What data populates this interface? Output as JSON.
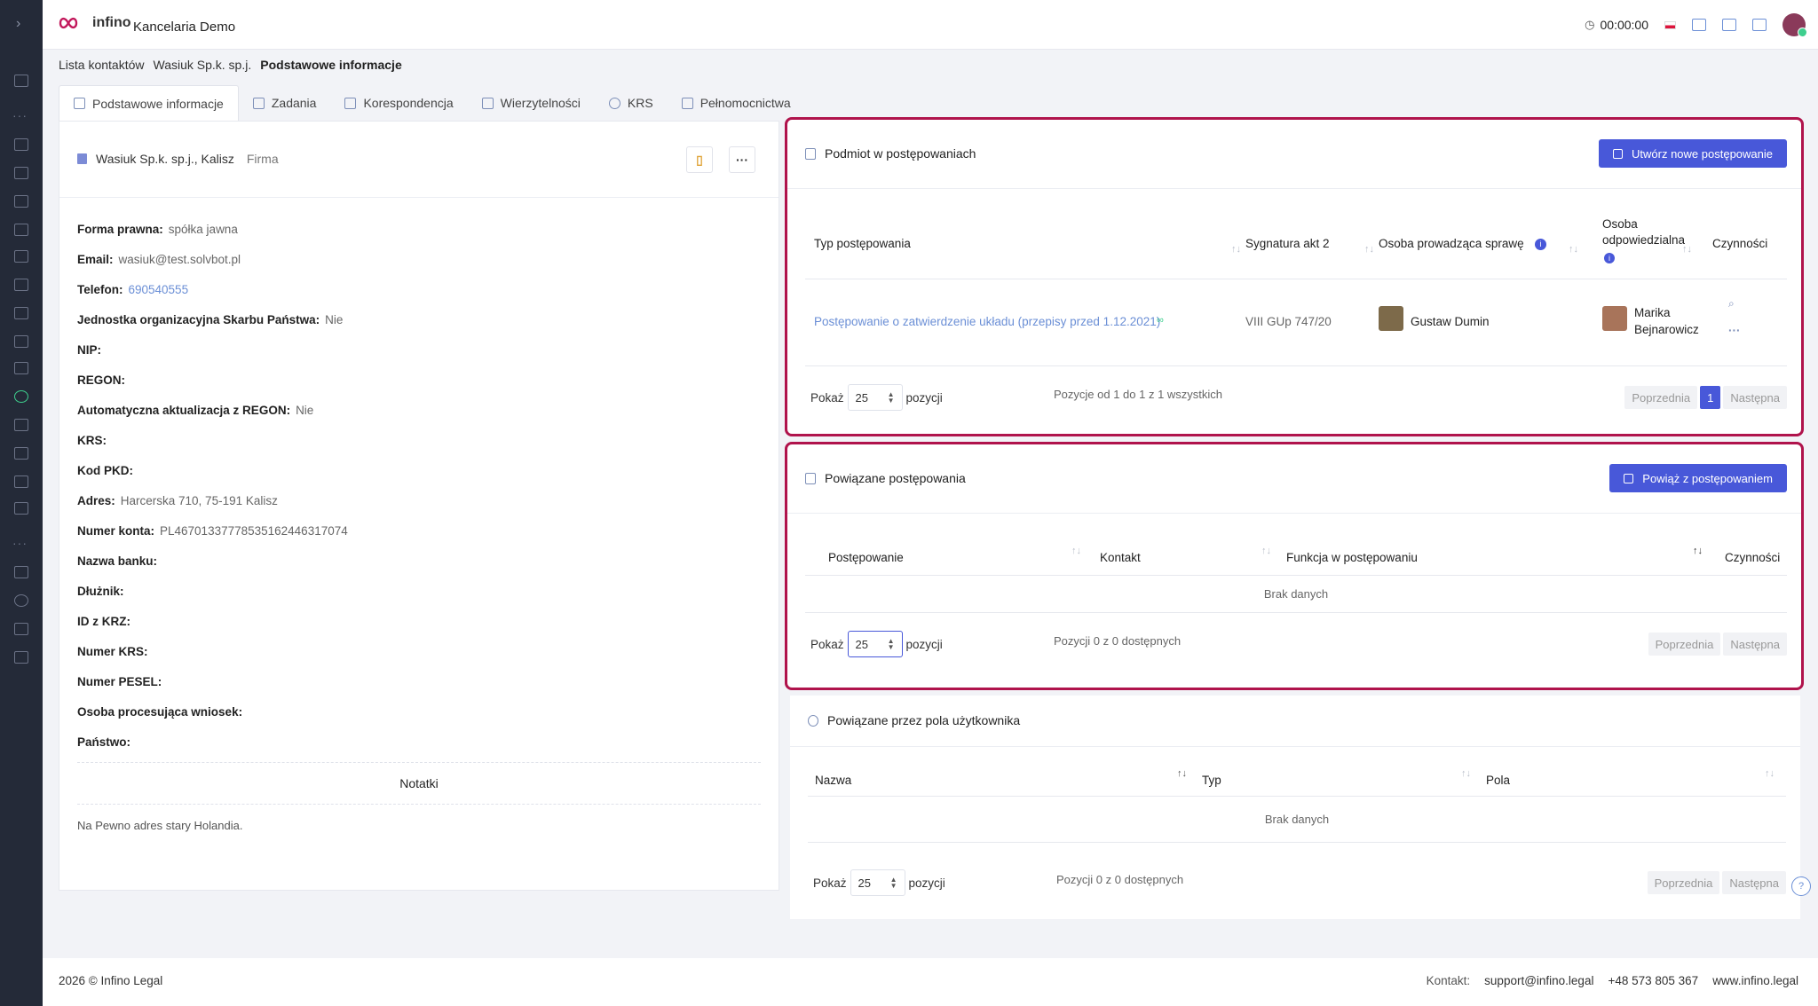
{
  "app": {
    "firm_name": "Kancelaria Demo",
    "logo_text": "infino",
    "timer": "00:00:00"
  },
  "breadcrumb": [
    "Lista kontaktów",
    "Wasiuk Sp.k. sp.j.",
    "Podstawowe informacje"
  ],
  "tabs": [
    "Podstawowe informacje",
    "Zadania",
    "Korespondencja",
    "Wierzytelności",
    "KRS",
    "Pełnomocnictwa"
  ],
  "left": {
    "title": "Wasiuk Sp.k. sp.j., Kalisz",
    "type": "Firma",
    "fields": [
      {
        "label": "Forma prawna:",
        "value": "spółka jawna"
      },
      {
        "label": "Email:",
        "value": "wasiuk@test.solvbot.pl"
      },
      {
        "label": "Telefon:",
        "value": "690540555"
      },
      {
        "label": "Jednostka organizacyjna Skarbu Państwa:",
        "value": "Nie"
      },
      {
        "label": "NIP:",
        "value": ""
      },
      {
        "label": "REGON:",
        "value": ""
      },
      {
        "label": "Automatyczna aktualizacja z REGON:",
        "value": "Nie"
      },
      {
        "label": "KRS:",
        "value": ""
      },
      {
        "label": "Kod PKD:",
        "value": ""
      },
      {
        "label": "Adres:",
        "value": "Harcerska 710, 75-191 Kalisz"
      },
      {
        "label": "Numer konta:",
        "value": "PL46701337778535162446317074"
      },
      {
        "label": "Nazwa banku:",
        "value": ""
      },
      {
        "label": "Dłużnik:",
        "value": ""
      },
      {
        "label": "ID z KRZ:",
        "value": ""
      },
      {
        "label": "Numer KRS:",
        "value": ""
      },
      {
        "label": "Numer PESEL:",
        "value": ""
      },
      {
        "label": "Osoba procesująca wniosek:",
        "value": ""
      },
      {
        "label": "Państwo:",
        "value": ""
      }
    ],
    "notes_title": "Notatki",
    "note": "Na Pewno adres stary Holandia."
  },
  "card1": {
    "title": "Podmiot w postępowaniach",
    "button": "Utwórz nowe postępowanie",
    "cols": {
      "c1": "Typ postępowania",
      "c2": "Sygnatura akt 2",
      "c3": "Osoba prowadząca sprawę",
      "c4a": "Osoba",
      "c4b": "odpowiedzialna",
      "c5": "Czynności"
    },
    "row": {
      "type": "Postępowanie o zatwierdzenie układu (przepisy przed 1.12.2021)",
      "sig": "VIII GUp 747/20",
      "lead": "Gustaw Dumin",
      "resp1": "Marika",
      "resp2": "Bejnarowicz"
    },
    "show": "Pokaż",
    "size": "25",
    "items": "pozycji",
    "info": "Pozycje od 1 do 1 z 1 wszystkich",
    "prev": "Poprzednia",
    "page": "1",
    "next": "Następna"
  },
  "card2": {
    "title": "Powiązane postępowania",
    "button": "Powiąż z postępowaniem",
    "cols": {
      "c1": "Postępowanie",
      "c2": "Kontakt",
      "c3": "Funkcja w postępowaniu",
      "c4": "Czynności"
    },
    "empty": "Brak danych",
    "show": "Pokaż",
    "size": "25",
    "items": "pozycji",
    "info": "Pozycji 0 z 0 dostępnych",
    "prev": "Poprzednia",
    "next": "Następna"
  },
  "card3": {
    "title": "Powiązane przez pola użytkownika",
    "cols": {
      "c1": "Nazwa",
      "c2": "Typ",
      "c3": "Pola"
    },
    "empty": "Brak danych",
    "show": "Pokaż",
    "size": "25",
    "items": "pozycji",
    "info": "Pozycji 0 z 0 dostępnych",
    "prev": "Poprzednia",
    "next": "Następna"
  },
  "footer": {
    "copy": "2026 © Infino Legal",
    "contact_label": "Kontakt:",
    "email": "support@infino.legal",
    "phone": "+48 573 805 367",
    "site": "www.infino.legal"
  },
  "colors": {
    "accent": "#4858d9",
    "highlight": "#b0134c",
    "sidebar": "#242a38"
  }
}
